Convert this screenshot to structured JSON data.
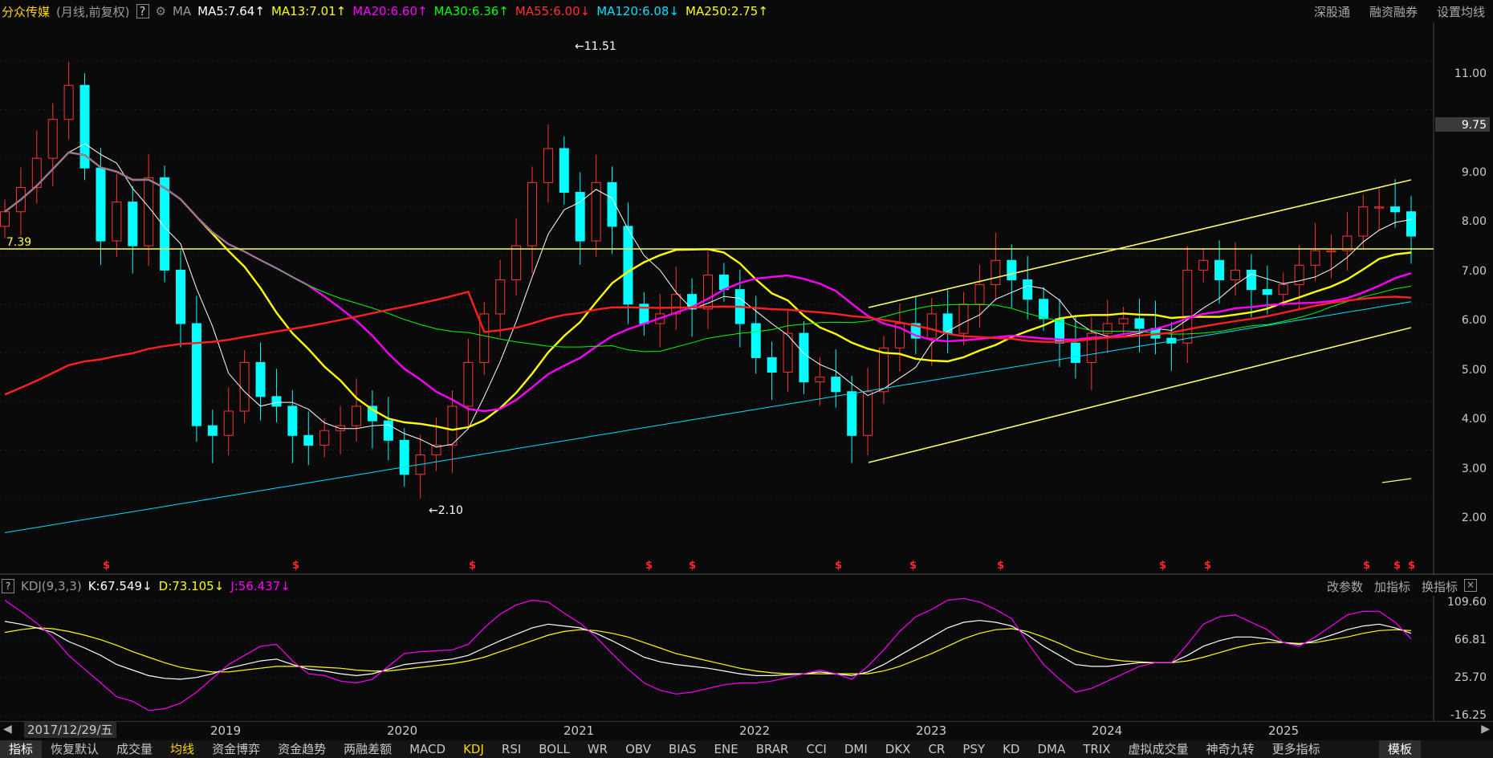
{
  "header": {
    "stock_name": "分众传媒",
    "period": "(月线,前复权)",
    "help": "?",
    "ma_label": "MA",
    "ma_items": [
      {
        "text": "MA5:7.64↑",
        "color": "#ffffff"
      },
      {
        "text": "MA13:7.01↑",
        "color": "#ffff00"
      },
      {
        "text": "MA20:6.60↑",
        "color": "#ff00ff"
      },
      {
        "text": "MA30:6.36↑",
        "color": "#00ff00"
      },
      {
        "text": "MA55:6.00↓",
        "color": "#ff2020"
      },
      {
        "text": "MA120:6.08↓",
        "color": "#00e0ff"
      },
      {
        "text": "MA250:2.75↑",
        "color": "#ffff00"
      }
    ],
    "right_links": [
      "深股通",
      "融资融券",
      "设置均线"
    ]
  },
  "main_chart": {
    "y_ticks": [
      "11.00",
      "9.75",
      "9.00",
      "8.00",
      "7.00",
      "6.00",
      "5.00",
      "4.00",
      "3.00",
      "2.00"
    ],
    "current_price_label": "9.75",
    "hline_label": "7.39",
    "high_label": "←11.51",
    "low_label": "←2.10",
    "dollar_mark": "$"
  },
  "kdj": {
    "help": "?",
    "title": "KDJ(9,3,3)",
    "k": "K:67.549↓",
    "d": "D:73.105↓",
    "j": "J:56.437↓",
    "right_links": [
      "改参数",
      "加指标",
      "换指标"
    ],
    "close": "×",
    "y_ticks": [
      "109.60",
      "66.81",
      "25.70",
      "-16.25"
    ]
  },
  "timeline": {
    "date": "2017/12/29/五",
    "years": [
      "2019",
      "2020",
      "2021",
      "2022",
      "2023",
      "2024",
      "2025"
    ]
  },
  "bottom_tabs": [
    "指标",
    "恢复默认",
    "成交量",
    "均线",
    "资金博弈",
    "资金趋势",
    "两融差额",
    "MACD",
    "KDJ",
    "RSI",
    "BOLL",
    "WR",
    "OBV",
    "BIAS",
    "ENE",
    "BRAR",
    "CCI",
    "DMI",
    "DKX",
    "CR",
    "PSY",
    "KD",
    "DMA",
    "TRIX",
    "虚拟成交量",
    "神奇九转",
    "更多指标",
    "模板"
  ],
  "chart_data": {
    "type": "candlestick",
    "price_range": [
      1.0,
      11.5
    ],
    "series_colors": {
      "up": "#ff3333",
      "down": "#00ffff",
      "ma5": "#ffffff",
      "ma13": "#ffff00",
      "ma20": "#ff00ff",
      "ma30": "#00ff00",
      "ma55": "#ff2020",
      "ma120": "#00e0ff",
      "ma250": "#ffff00"
    },
    "close": [
      7.9,
      8.4,
      9.0,
      9.8,
      10.5,
      8.8,
      7.3,
      8.1,
      7.2,
      8.6,
      6.7,
      5.6,
      3.5,
      3.3,
      3.8,
      4.8,
      4.1,
      3.9,
      3.3,
      3.1,
      3.4,
      3.5,
      3.9,
      3.6,
      3.2,
      2.5,
      2.9,
      3.1,
      3.9,
      4.8,
      5.8,
      6.5,
      7.2,
      8.5,
      9.2,
      8.3,
      7.3,
      8.5,
      7.6,
      6.0,
      5.6,
      5.8,
      6.2,
      5.9,
      6.6,
      6.3,
      5.6,
      4.9,
      4.6,
      5.4,
      4.4,
      4.5,
      4.2,
      3.3,
      4.2,
      5.1,
      5.6,
      5.3,
      5.8,
      5.4,
      6.0,
      6.4,
      6.9,
      6.5,
      6.1,
      5.7,
      5.2,
      4.8,
      5.4,
      5.6,
      5.7,
      5.5,
      5.3,
      5.2,
      6.7,
      6.9,
      6.5,
      6.7,
      6.3,
      6.2,
      6.4,
      6.8,
      7.1,
      7.1,
      7.4,
      8.0,
      8.0,
      7.9,
      7.4
    ],
    "highs_lows": {
      "high": 11.51,
      "low": 2.1
    },
    "horizontal_line": 7.39,
    "kdj_range": [
      -16.25,
      109.6
    ],
    "kdj_k": [
      87,
      84,
      80,
      75,
      65,
      58,
      50,
      40,
      34,
      28,
      25,
      24,
      26,
      30,
      36,
      40,
      44,
      46,
      40,
      35,
      33,
      30,
      28,
      30,
      35,
      40,
      42,
      44,
      46,
      50,
      58,
      66,
      73,
      80,
      84,
      82,
      80,
      74,
      66,
      57,
      48,
      43,
      40,
      38,
      36,
      33,
      30,
      28,
      28,
      29,
      30,
      32,
      30,
      28,
      32,
      40,
      50,
      60,
      70,
      80,
      86,
      88,
      86,
      82,
      72,
      60,
      50,
      40,
      38,
      38,
      40,
      42,
      42,
      42,
      50,
      60,
      66,
      70,
      70,
      68,
      64,
      62,
      66,
      72,
      78,
      82,
      84,
      80,
      74
    ],
    "kdj_d": [
      75,
      78,
      80,
      79,
      76,
      72,
      67,
      61,
      54,
      48,
      42,
      37,
      34,
      32,
      32,
      34,
      36,
      38,
      38,
      38,
      37,
      36,
      34,
      33,
      33,
      35,
      37,
      39,
      41,
      44,
      48,
      54,
      60,
      66,
      72,
      76,
      78,
      77,
      74,
      70,
      64,
      58,
      52,
      48,
      44,
      40,
      36,
      33,
      31,
      30,
      30,
      30,
      30,
      30,
      30,
      33,
      38,
      45,
      52,
      60,
      68,
      74,
      78,
      79,
      76,
      70,
      63,
      55,
      50,
      46,
      44,
      43,
      42,
      42,
      44,
      48,
      53,
      58,
      62,
      64,
      64,
      63,
      64,
      67,
      70,
      74,
      77,
      78,
      77
    ],
    "kdj_j": [
      110,
      98,
      85,
      70,
      50,
      35,
      20,
      5,
      0,
      -10,
      -8,
      -2,
      10,
      25,
      40,
      50,
      60,
      62,
      44,
      30,
      28,
      22,
      20,
      24,
      38,
      52,
      54,
      55,
      56,
      62,
      80,
      95,
      105,
      110,
      108,
      96,
      85,
      70,
      52,
      35,
      20,
      12,
      8,
      10,
      14,
      18,
      20,
      20,
      22,
      26,
      30,
      34,
      30,
      24,
      38,
      56,
      76,
      92,
      100,
      110,
      112,
      108,
      100,
      90,
      64,
      40,
      24,
      10,
      14,
      22,
      30,
      38,
      42,
      42,
      62,
      84,
      92,
      94,
      86,
      78,
      64,
      60,
      70,
      82,
      94,
      98,
      98,
      86,
      68
    ]
  }
}
